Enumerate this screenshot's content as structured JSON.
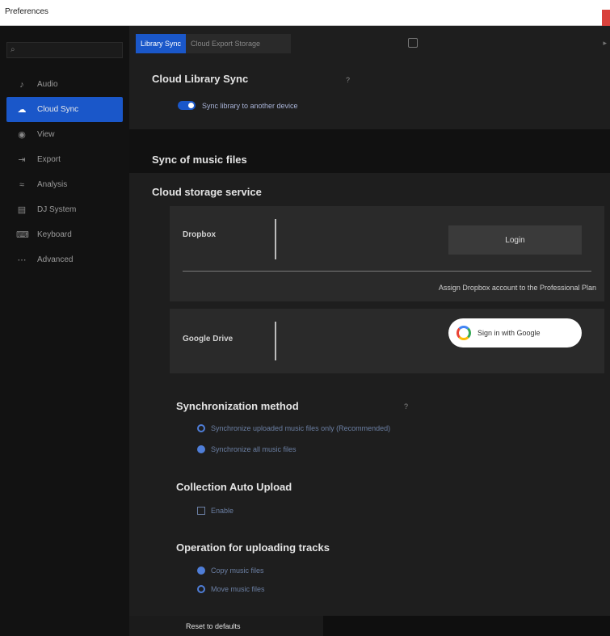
{
  "window": {
    "title": "Preferences"
  },
  "sidebar": {
    "search_placeholder": "",
    "items": [
      {
        "label": "Audio",
        "icon": "speaker-icon",
        "glyph": "♪"
      },
      {
        "label": "Cloud Sync",
        "icon": "cloud-icon",
        "glyph": "☁"
      },
      {
        "label": "View",
        "icon": "eye-icon",
        "glyph": "◉"
      },
      {
        "label": "Export",
        "icon": "export-icon",
        "glyph": "⇥"
      },
      {
        "label": "Analysis",
        "icon": "analysis-icon",
        "glyph": "≈"
      },
      {
        "label": "DJ System",
        "icon": "dj-system-icon",
        "glyph": "▤"
      },
      {
        "label": "Keyboard",
        "icon": "keyboard-icon",
        "glyph": "⌨"
      },
      {
        "label": "Advanced",
        "icon": "advanced-icon",
        "glyph": "⋯"
      }
    ]
  },
  "tabs": {
    "active": "Library Sync",
    "other": "Cloud Export Storage"
  },
  "sync": {
    "title": "Cloud Library Sync",
    "help": "?",
    "toggle_label": "Sync library to another device",
    "toggle_on": true
  },
  "music_files": {
    "title": "Sync of music files"
  },
  "storage": {
    "title": "Cloud storage service",
    "dropbox": {
      "label": "Dropbox",
      "login_label": "Login",
      "assign_text": "Assign Dropbox account to the Professional Plan"
    },
    "google": {
      "label": "Google Drive",
      "signin_label": "Sign in with Google"
    }
  },
  "sync_method": {
    "title": "Synchronization method",
    "help": "?",
    "options": [
      {
        "label": "Synchronize uploaded music files only (Recommended)",
        "selected": false
      },
      {
        "label": "Synchronize all music files",
        "selected": true
      }
    ]
  },
  "auto_upload": {
    "title": "Collection Auto Upload",
    "toggle_label": "Enable",
    "toggle_on": false
  },
  "upload_op": {
    "title": "Operation for uploading tracks",
    "options": [
      {
        "label": "Copy music files",
        "selected": true
      },
      {
        "label": "Move music files",
        "selected": false
      }
    ]
  },
  "footer": {
    "reset_label": "Reset to defaults"
  },
  "colors": {
    "accent": "#1a57c9",
    "background": "#1e1e1e",
    "sidebar": "#121212"
  }
}
